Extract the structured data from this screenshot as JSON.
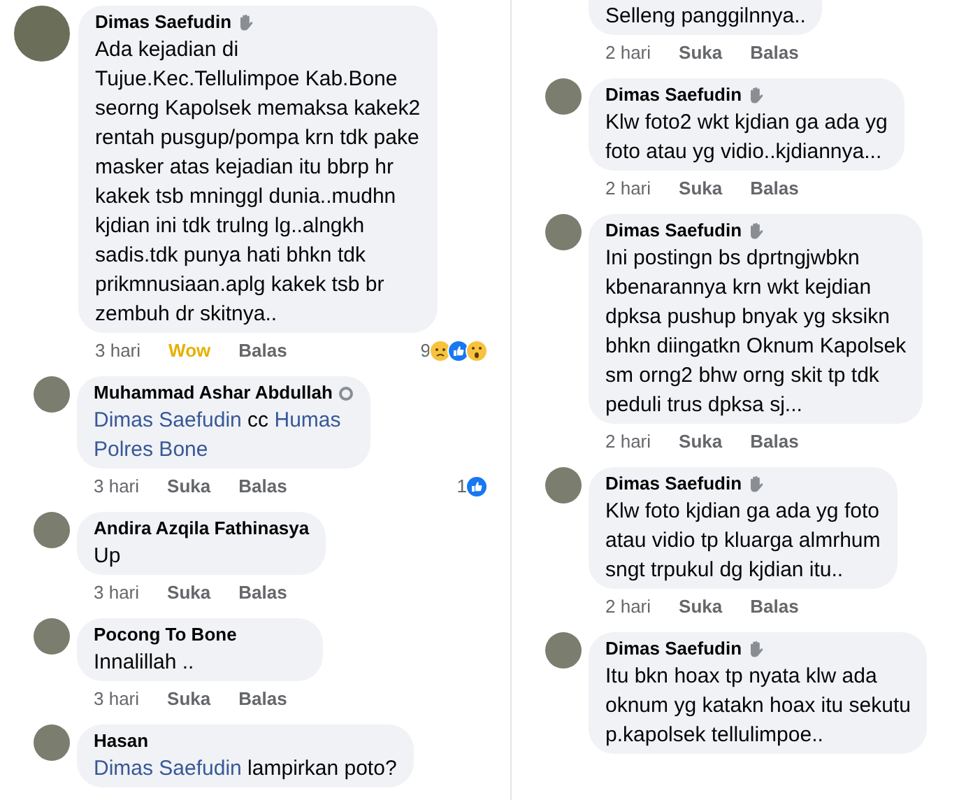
{
  "columns": [
    {
      "comments": [
        {
          "avatar": true,
          "kind": "comment",
          "name": "Dimas Saefudin",
          "badge": {
            "kind": "wave"
          },
          "lines": [
            [
              {
                "text": "Ada kejadian di"
              }
            ],
            [
              {
                "text": "Tujue.Kec.Tellulimpoe Kab.Bone"
              }
            ],
            [
              {
                "text": "seorng Kapolsek memaksa kakek2"
              }
            ],
            [
              {
                "text": "rentah pusgup/pompa krn tdk pake"
              }
            ],
            [
              {
                "text": "masker atas kejadian itu bbrp hr"
              }
            ],
            [
              {
                "text": "kakek tsb mninggl dunia..mudhn"
              }
            ],
            [
              {
                "text": "kjdian ini tdk trulng lg..alngkh"
              }
            ],
            [
              {
                "text": "sadis.tdk punya hati bhkn tdk"
              }
            ],
            [
              {
                "text": "prikmnusiaan.aplg kakek tsb br"
              }
            ],
            [
              {
                "text": "zembuh dr skitnya.."
              }
            ]
          ],
          "time": "3 hari",
          "like_label": "Wow",
          "reacted": true,
          "reply_label": "Balas",
          "reactions": {
            "count": "9",
            "icons": [
              {
                "kind": "sad"
              },
              {
                "kind": "like"
              },
              {
                "kind": "wow"
              }
            ]
          }
        },
        {
          "avatar": true,
          "kind": "reply",
          "name": "Muhammad Ashar Abdullah",
          "badge": {
            "kind": "shield"
          },
          "lines": [
            [
              {
                "text": "Dimas Saefudin",
                "kind": "mention"
              },
              {
                "text": " cc ",
                "kind": "plain"
              },
              {
                "text": "Humas",
                "kind": "mention"
              }
            ],
            [
              {
                "text": "Polres Bone",
                "kind": "mention"
              }
            ]
          ],
          "time": "3 hari",
          "like_label": "Suka",
          "reacted": false,
          "reply_label": "Balas",
          "reactions": {
            "count": "1",
            "icons": [
              {
                "kind": "like"
              }
            ]
          }
        },
        {
          "avatar": true,
          "kind": "reply",
          "name": "Andira Azqila Fathinasya",
          "lines": [
            [
              {
                "text": "Up"
              }
            ]
          ],
          "time": "3 hari",
          "like_label": "Suka",
          "reacted": false,
          "reply_label": "Balas"
        },
        {
          "avatar": true,
          "kind": "reply",
          "name": "Pocong To Bone",
          "lines": [
            [
              {
                "text": "Innalillah .."
              }
            ]
          ],
          "time": "3 hari",
          "like_label": "Suka",
          "reacted": false,
          "reply_label": "Balas"
        },
        {
          "avatar": true,
          "kind": "reply",
          "name": "Hasan",
          "lines": [
            [
              {
                "text": "Dimas Saefudin",
                "kind": "mention"
              },
              {
                "text": " lampirkan poto?",
                "kind": "plain"
              }
            ]
          ]
        }
      ]
    },
    {
      "comments": [
        {
          "avatar": false,
          "kind": "reply",
          "lines": [
            [
              {
                "text": "Selleng panggilnnya.."
              }
            ]
          ],
          "time": "2 hari",
          "like_label": "Suka",
          "reacted": false,
          "reply_label": "Balas"
        },
        {
          "avatar": true,
          "kind": "reply",
          "name": "Dimas Saefudin",
          "badge": {
            "kind": "wave"
          },
          "lines": [
            [
              {
                "text": "Klw foto2 wkt kjdian ga ada yg"
              }
            ],
            [
              {
                "text": "foto atau yg vidio..kjdiannya..."
              }
            ]
          ],
          "time": "2 hari",
          "like_label": "Suka",
          "reacted": false,
          "reply_label": "Balas"
        },
        {
          "avatar": true,
          "kind": "reply",
          "name": "Dimas Saefudin",
          "badge": {
            "kind": "wave"
          },
          "lines": [
            [
              {
                "text": "Ini postingn bs dprtngjwbkn"
              }
            ],
            [
              {
                "text": "kbenarannya krn wkt kejdian"
              }
            ],
            [
              {
                "text": "dpksa pushup bnyak yg sksikn"
              }
            ],
            [
              {
                "text": "bhkn diingatkn Oknum Kapolsek"
              }
            ],
            [
              {
                "text": "sm orng2 bhw orng skit tp tdk"
              }
            ],
            [
              {
                "text": "peduli trus dpksa sj..."
              }
            ]
          ],
          "time": "2 hari",
          "like_label": "Suka",
          "reacted": false,
          "reply_label": "Balas"
        },
        {
          "avatar": true,
          "kind": "reply",
          "name": "Dimas Saefudin",
          "badge": {
            "kind": "wave"
          },
          "lines": [
            [
              {
                "text": "Klw foto kjdian ga ada yg foto"
              }
            ],
            [
              {
                "text": "atau vidio tp kluarga almrhum"
              }
            ],
            [
              {
                "text": "sngt trpukul dg kjdian itu.."
              }
            ]
          ],
          "time": "2 hari",
          "like_label": "Suka",
          "reacted": false,
          "reply_label": "Balas"
        },
        {
          "avatar": true,
          "kind": "reply",
          "name": "Dimas Saefudin",
          "badge": {
            "kind": "wave"
          },
          "lines": [
            [
              {
                "text": "Itu bkn hoax tp nyata klw ada"
              }
            ],
            [
              {
                "text": "oknum yg katakn hoax itu sekutu"
              }
            ],
            [
              {
                "text": "p.kapolsek tellulimpoe.."
              }
            ]
          ]
        }
      ]
    }
  ]
}
